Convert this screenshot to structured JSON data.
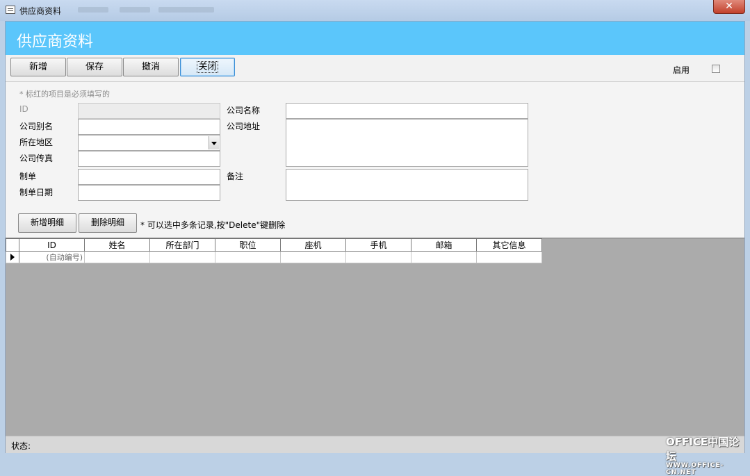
{
  "window": {
    "title": "供应商资料",
    "close_glyph": "✕"
  },
  "form": {
    "header": "供应商资料"
  },
  "toolbar": {
    "buttons": [
      "新增",
      "保存",
      "撤消",
      "关闭"
    ],
    "enable_label": "启用",
    "enable_checked": false
  },
  "note": "* 标红的项目是必须填写的",
  "fields": {
    "id_label": "ID",
    "alias_label": "公司别名",
    "region_label": "所在地区",
    "fax_label": "公司传真",
    "creator_label": "制单",
    "create_date_label": "制单日期",
    "company_name_label": "公司名称",
    "address_label": "公司地址",
    "remarks_label": "备注"
  },
  "detail": {
    "add_button": "新增明细",
    "delete_button": "删除明细",
    "hint": "* 可以选中多条记录,按\"Delete\"键删除"
  },
  "grid": {
    "columns": [
      "ID",
      "姓名",
      "所在部门",
      "职位",
      "座机",
      "手机",
      "邮箱",
      "其它信息"
    ],
    "new_row_id": "(自动编号)"
  },
  "status": {
    "label": "状态:"
  },
  "watermark": {
    "line1": "OFFICE中国论坛",
    "line2": "WWW.OFFICE-CN.NET"
  },
  "colors": {
    "header_band": "#5bc6fb",
    "close_button": "#c2402c"
  }
}
